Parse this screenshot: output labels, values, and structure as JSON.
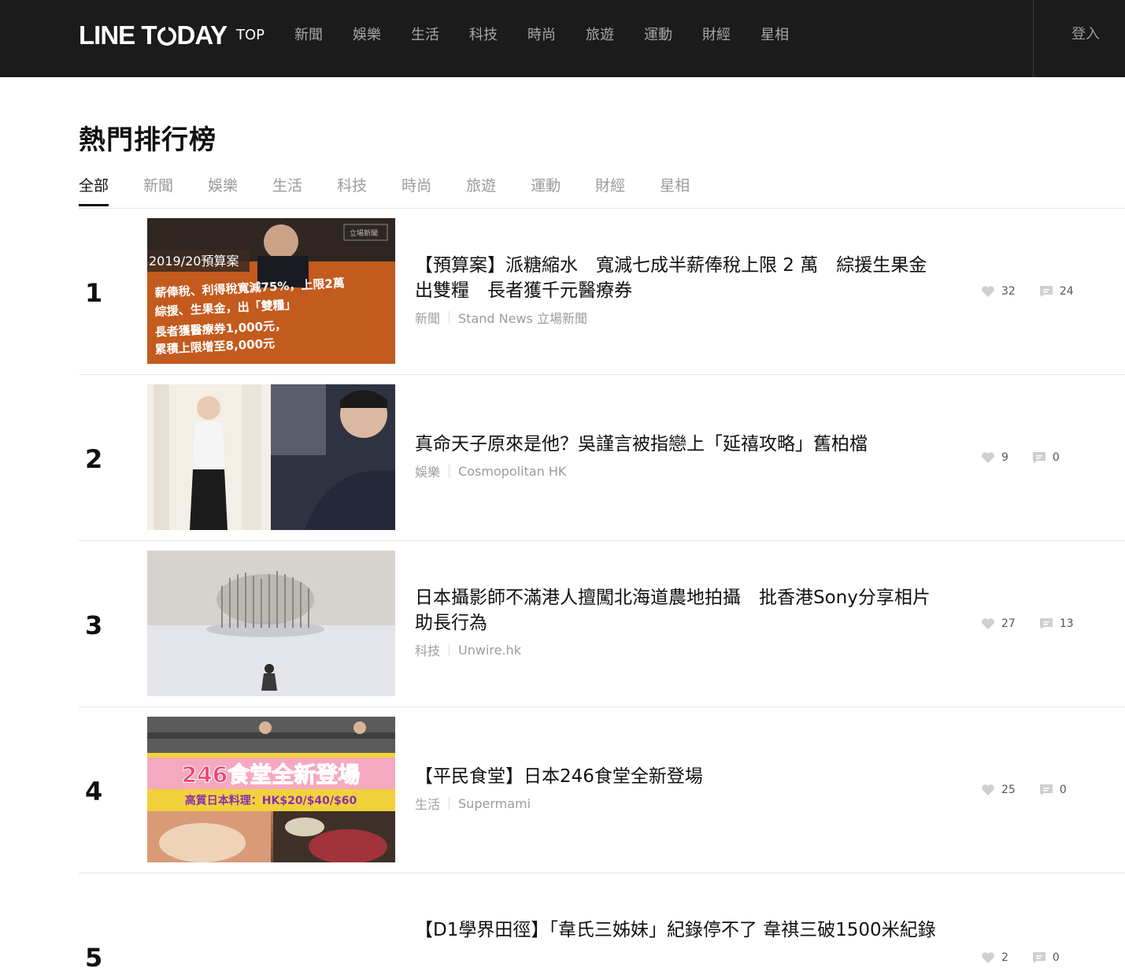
{
  "header": {
    "logo_left": "LINE T",
    "logo_right": "DAY",
    "nav": [
      "TOP",
      "新聞",
      "娛樂",
      "生活",
      "科技",
      "時尚",
      "旅遊",
      "運動",
      "財經",
      "星相"
    ],
    "login": "登入"
  },
  "page": {
    "title": "熱門排行榜",
    "tabs": [
      "全部",
      "新聞",
      "娛樂",
      "生活",
      "科技",
      "時尚",
      "旅遊",
      "運動",
      "財經",
      "星相"
    ]
  },
  "articles": [
    {
      "rank": "1",
      "headline": "【預算案】派糖縮水　寬減七成半薪俸稅上限 2 萬　綜援生果金出雙糧　長者獲千元醫療券",
      "category": "新聞",
      "source": "Stand News 立場新聞",
      "likes": "32",
      "comments": "24",
      "thumb_lines": [
        "2019/20預算案",
        "薪俸稅、利得稅寬減75%，上限2萬",
        "綜援、生果金，出「雙糧」",
        "長者獲醫療券1,000元，",
        "累積上限增至8,000元"
      ],
      "thumb_watermark": "立場新聞"
    },
    {
      "rank": "2",
      "headline": "真命天子原來是他？吳謹言被指戀上「延禧攻略」舊柏檔",
      "category": "娛樂",
      "source": "Cosmopolitan HK",
      "likes": "9",
      "comments": "0"
    },
    {
      "rank": "3",
      "headline": "日本攝影師不滿港人擅闖北海道農地拍攝　批香港Sony分享相片助長行為",
      "category": "科技",
      "source": "Unwire.hk",
      "likes": "27",
      "comments": "13"
    },
    {
      "rank": "4",
      "headline": "【平民食堂】日本246食堂全新登場",
      "category": "生活",
      "source": "Supermami",
      "likes": "25",
      "comments": "0",
      "thumb_lines": [
        "246食堂全新登場",
        "高質日本料理：HK$20/$40/$60"
      ]
    },
    {
      "rank": "5",
      "headline": "【D1學界田徑】「韋氏三姊妹」紀錄停不了 韋祺三破1500米紀錄",
      "likes": "2",
      "comments": "0"
    }
  ]
}
